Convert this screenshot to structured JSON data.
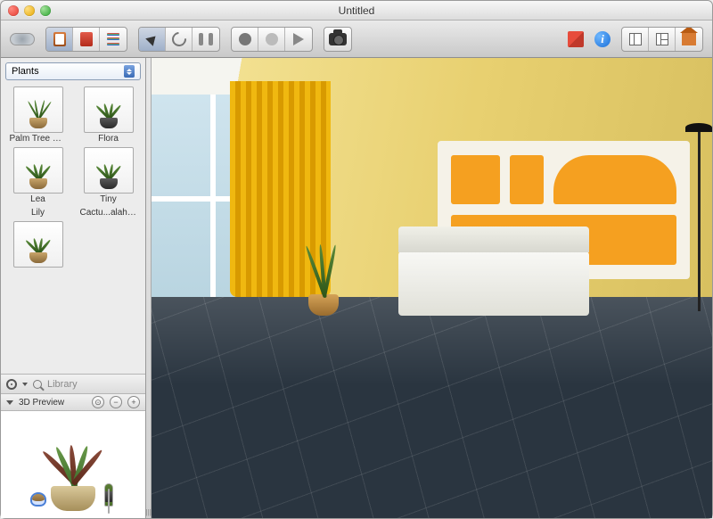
{
  "window": {
    "title": "Untitled"
  },
  "sidebar": {
    "category": "Plants",
    "items": [
      {
        "label": "Palm Tree High",
        "kind": "palm"
      },
      {
        "label": "Flora",
        "kind": "bushy"
      },
      {
        "label": "Lea",
        "kind": "bushy"
      },
      {
        "label": "Tiny",
        "kind": "bushy"
      },
      {
        "label": "Lily",
        "kind": "pineapple",
        "selected": true
      },
      {
        "label": "Cactu...alahari",
        "kind": "cactus"
      },
      {
        "label": "",
        "kind": "bushy"
      },
      {
        "label": "",
        "kind": "rose"
      }
    ],
    "search_placeholder": "Library"
  },
  "preview": {
    "title": "3D Preview"
  }
}
